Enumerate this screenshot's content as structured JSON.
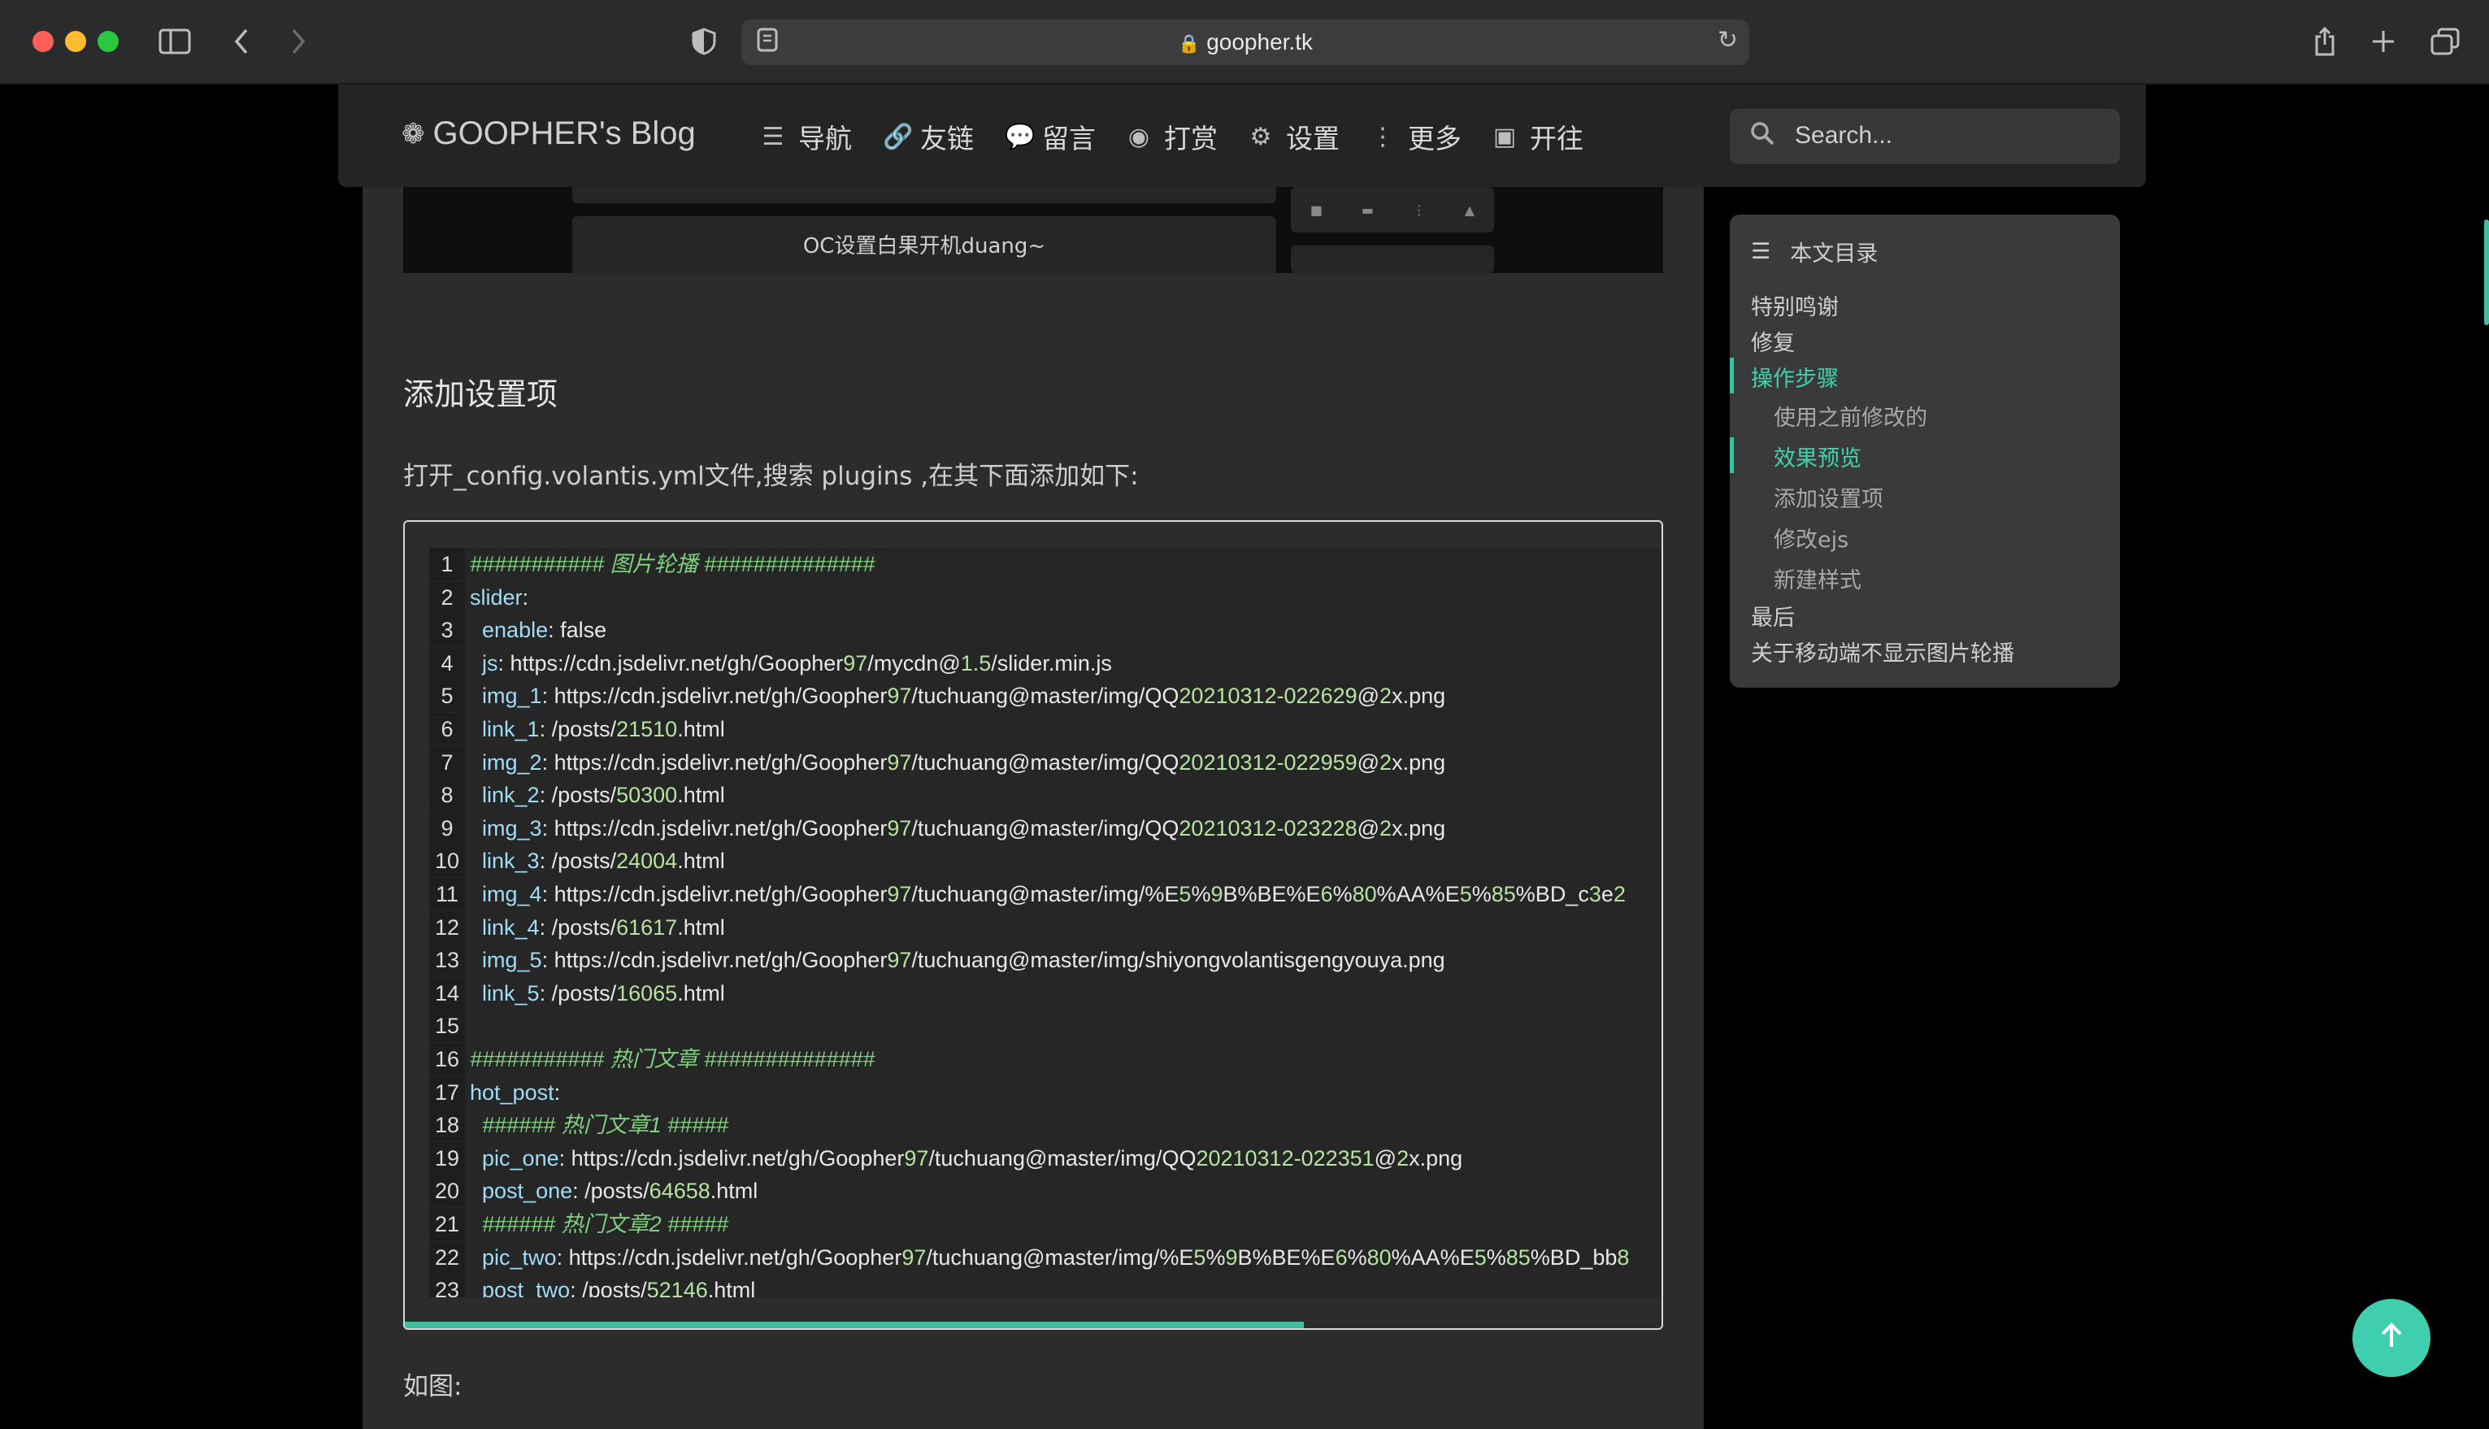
{
  "browser": {
    "url": "goopher.tk",
    "sidebar_icon": "sidebar-icon",
    "back_icon": "chevron-left-icon",
    "forward_icon": "chevron-right-icon"
  },
  "navbar": {
    "brand": "GOOPHER's Blog",
    "items": [
      {
        "icon": "list-icon",
        "label": "导航"
      },
      {
        "icon": "link-icon",
        "label": "友链"
      },
      {
        "icon": "comment-icon",
        "label": "留言"
      },
      {
        "icon": "dollar-icon",
        "label": "打赏"
      },
      {
        "icon": "gear-icon",
        "label": "设置"
      },
      {
        "icon": "more-vertical-icon",
        "label": "更多"
      },
      {
        "icon": "open-icon",
        "label": "开往"
      }
    ],
    "search_placeholder": "Search..."
  },
  "preview": {
    "card_text": "OC设置白果开机duang~"
  },
  "article": {
    "heading": "添加设置项",
    "intro": "打开_config.volantis.yml文件,搜索 plugins ,在其下面添加如下:",
    "after_code": "如图:"
  },
  "code_lines": [
    "########### 图片轮播 ##############",
    "slider:",
    "  enable: false",
    "  js: https://cdn.jsdelivr.net/gh/Goopher97/mycdn@1.5/slider.min.js",
    "  img_1: https://cdn.jsdelivr.net/gh/Goopher97/tuchuang@master/img/QQ20210312-022629@2x.png",
    "  link_1: /posts/21510.html",
    "  img_2: https://cdn.jsdelivr.net/gh/Goopher97/tuchuang@master/img/QQ20210312-022959@2x.png",
    "  link_2: /posts/50300.html",
    "  img_3: https://cdn.jsdelivr.net/gh/Goopher97/tuchuang@master/img/QQ20210312-023228@2x.png",
    "  link_3: /posts/24004.html",
    "  img_4: https://cdn.jsdelivr.net/gh/Goopher97/tuchuang@master/img/%E5%9B%BE%E6%80%AA%E5%85%BD_c3e2",
    "  link_4: /posts/61617.html",
    "  img_5: https://cdn.jsdelivr.net/gh/Goopher97/tuchuang@master/img/shiyongvolantisgengyouya.png",
    "  link_5: /posts/16065.html",
    "",
    "########### 热门文章 ##############",
    "hot_post:",
    "  ###### 热门文章1 #####",
    "  pic_one: https://cdn.jsdelivr.net/gh/Goopher97/tuchuang@master/img/QQ20210312-022351@2x.png",
    "  post_one: /posts/64658.html",
    "  ###### 热门文章2 #####",
    "  pic_two: https://cdn.jsdelivr.net/gh/Goopher97/tuchuang@master/img/%E5%9B%BE%E6%80%AA%E5%85%BD_bb8",
    "  post_two: /posts/52146.html"
  ],
  "toc": {
    "title": "本文目录",
    "items": [
      {
        "label": "特别鸣谢",
        "level": 1,
        "active": false
      },
      {
        "label": "修复",
        "level": 1,
        "active": false
      },
      {
        "label": "操作步骤",
        "level": 1,
        "active": true
      },
      {
        "label": "使用之前修改的",
        "level": 2,
        "active": false
      },
      {
        "label": "效果预览",
        "level": 2,
        "active": true
      },
      {
        "label": "添加设置项",
        "level": 2,
        "active": false
      },
      {
        "label": "修改ejs",
        "level": 2,
        "active": false
      },
      {
        "label": "新建样式",
        "level": 2,
        "active": false
      },
      {
        "label": "最后",
        "level": 1,
        "active": false
      },
      {
        "label": "关于移动端不显示图片轮播",
        "level": 1,
        "active": false
      }
    ]
  },
  "colors": {
    "accent": "#3fbf9f",
    "number": "#b6e3a1",
    "key": "#9fdcf6",
    "comment": "#7fd17f"
  }
}
